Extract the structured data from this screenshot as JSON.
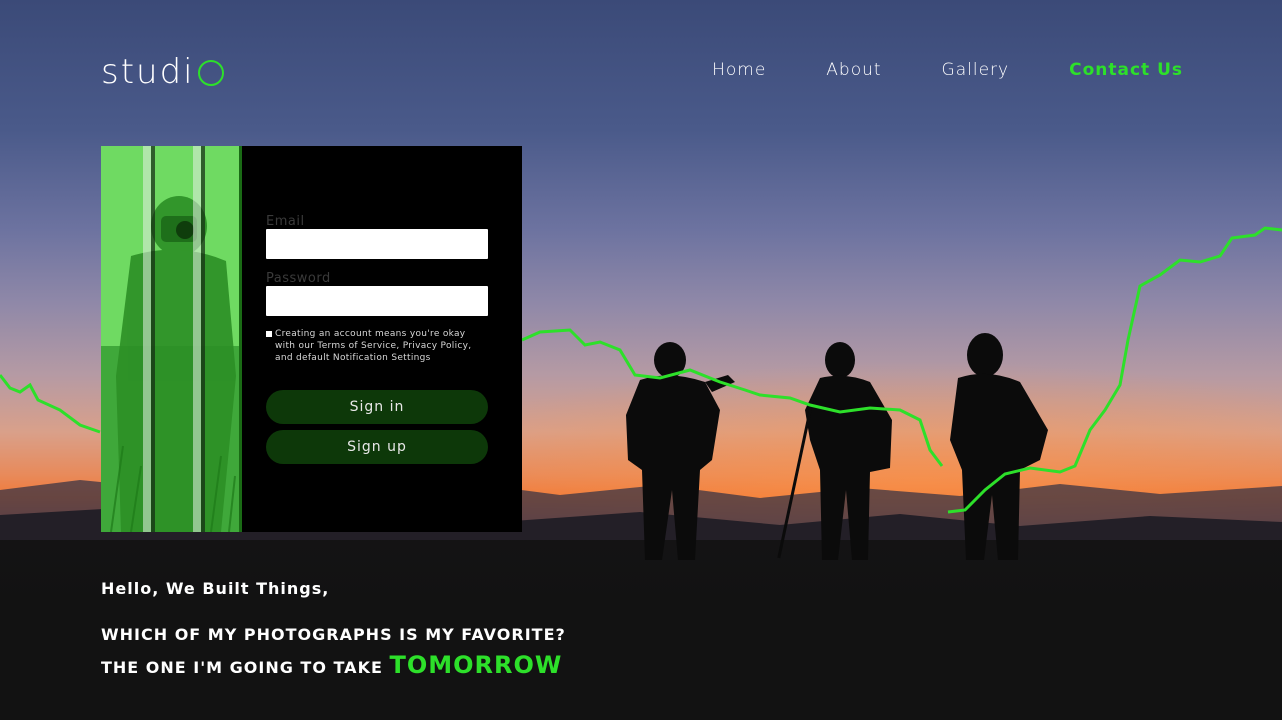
{
  "brand": {
    "logo_text": "studi",
    "accent": "#2de02a"
  },
  "nav": {
    "items": [
      {
        "label": "Home",
        "active": false
      },
      {
        "label": "About",
        "active": false
      },
      {
        "label": "Gallery",
        "active": false
      },
      {
        "label": "Contact Us",
        "active": true
      }
    ]
  },
  "form": {
    "email_label": "Email",
    "email_value": "",
    "password_label": "Password",
    "password_value": "",
    "terms_text": "Creating an account means you're okay with our Terms of Service, Privacy Policy, and default Notification Settings",
    "terms_checked": true,
    "signin_label": "Sign in",
    "signup_label": "Sign up"
  },
  "hero": {
    "greeting": "Hello, We Built Things,",
    "line1": "WHICH OF MY PHOTOGRAPHS IS MY FAVORITE?",
    "line2_prefix": "THE ONE I'M GOING TO TAKE",
    "line2_highlight": "TOMORROW"
  },
  "colors": {
    "accent": "#2de02a",
    "button_bg": "#0d3809",
    "card_bg": "#000000",
    "ground": "#121212"
  }
}
